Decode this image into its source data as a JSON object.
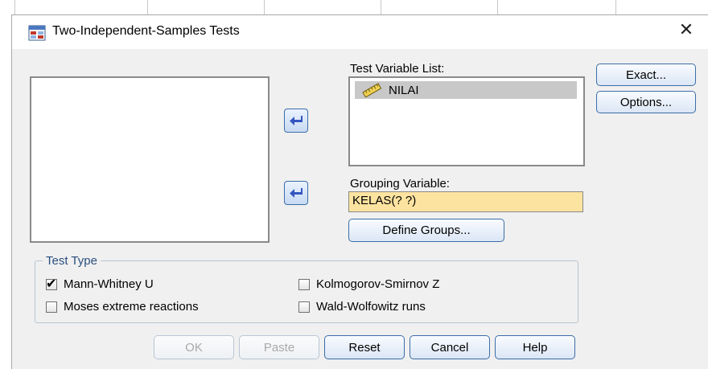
{
  "dialog": {
    "title": "Two-Independent-Samples Tests",
    "close_glyph": "✕"
  },
  "test_variable_list": {
    "label": "Test Variable List:",
    "items": [
      {
        "label": "NILAI",
        "icon": "scale-ruler-icon",
        "selected": true
      }
    ]
  },
  "grouping_variable": {
    "label": "Grouping Variable:",
    "value": "KELAS(? ?)",
    "highlight_color": "#fde3a0"
  },
  "buttons": {
    "exact": "Exact...",
    "options": "Options...",
    "define_groups": "Define Groups...",
    "ok": "OK",
    "paste": "Paste",
    "reset": "Reset",
    "cancel": "Cancel",
    "help": "Help"
  },
  "test_type": {
    "legend": "Test Type",
    "options": [
      {
        "label": "Mann-Whitney U",
        "checked": true
      },
      {
        "label": "Kolmogorov-Smirnov Z",
        "checked": false
      },
      {
        "label": "Moses extreme reactions",
        "checked": false
      },
      {
        "label": "Wald-Wolfowitz runs",
        "checked": false
      }
    ]
  },
  "colors": {
    "button_border": "#3b6ea8",
    "arrow_color": "#3356c0",
    "dialog_bg": "#f0f0f0"
  }
}
